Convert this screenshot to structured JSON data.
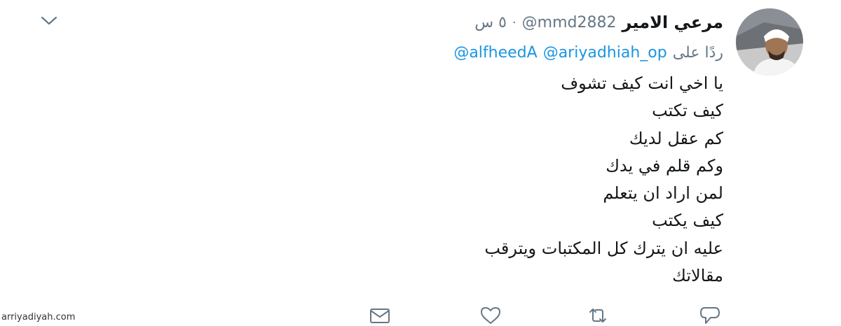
{
  "tweet": {
    "author_name": "مرعي الامير",
    "handle": "@mmd2882",
    "separator": "·",
    "time": "٥ س",
    "reply_prefix": "ردًا على",
    "reply_mentions": [
      "@ariyadhiah_op",
      "@alfheedA"
    ],
    "lines": [
      "يا اخي انت كيف تشوف",
      "كيف تكتب",
      "كم عقل لديك",
      "وكم قلم في يدك",
      "لمن  اراد ان يتعلم",
      "كيف يكتب",
      "عليه ان يترك كل المكتبات ويترقب",
      "مقالاتك"
    ]
  },
  "icons": {
    "more": "chevron-down-icon",
    "actions": [
      "reply-icon",
      "retweet-icon",
      "like-icon",
      "message-icon"
    ]
  },
  "watermark": "arriyadiyah.com",
  "colors": {
    "text": "#14171a",
    "muted": "#657786",
    "link": "#1b95e0",
    "icon": "#657786"
  }
}
